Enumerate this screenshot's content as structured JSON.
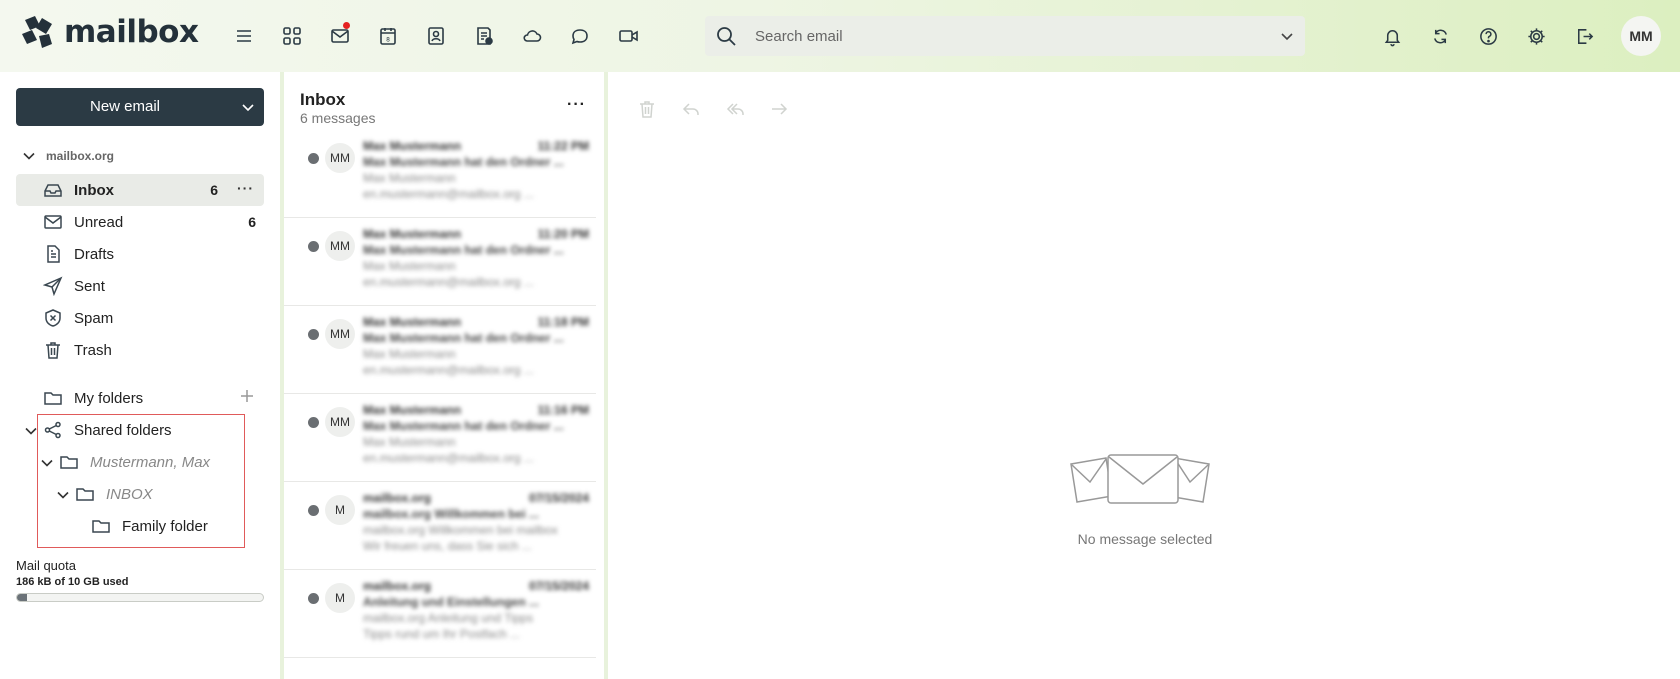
{
  "app": {
    "logo_text": "mailbox"
  },
  "topbar": {
    "icons": [
      "menu-icon",
      "apps-grid-icon",
      "mail-icon",
      "calendar-icon",
      "contacts-icon",
      "tasks-icon",
      "cloud-icon",
      "chat-icon",
      "video-icon"
    ],
    "calendar_day": "8",
    "search_placeholder": "Search email",
    "right_icons": [
      "bell-icon",
      "refresh-icon",
      "help-icon",
      "settings-icon",
      "logout-icon"
    ],
    "avatar_initials": "MM"
  },
  "sidebar": {
    "new_email_label": "New email",
    "account": "mailbox.org",
    "folders": [
      {
        "label": "Inbox",
        "count": "6",
        "icon": "inbox-icon",
        "active": true
      },
      {
        "label": "Unread",
        "count": "6",
        "icon": "envelope-icon"
      },
      {
        "label": "Drafts",
        "icon": "draft-icon"
      },
      {
        "label": "Sent",
        "icon": "send-icon"
      },
      {
        "label": "Spam",
        "icon": "shield-x-icon"
      },
      {
        "label": "Trash",
        "icon": "trash-icon"
      }
    ],
    "my_folders": "My folders",
    "shared_folders": "Shared folders",
    "shared_tree": [
      {
        "label": "Mustermann, Max",
        "italic": true
      },
      {
        "label": "INBOX",
        "italic": true
      },
      {
        "label": "Family folder"
      }
    ],
    "quota_label": "Mail quota",
    "quota_value": "186 kB of 10 GB used",
    "quota_fraction": 0.04
  },
  "list": {
    "title": "Inbox",
    "subtitle": "6 messages",
    "messages": [
      {
        "initials": "MM",
        "from": "Max Mustermann",
        "time": "11:22 PM",
        "subject": "Max Mustermann hat den Ordner ...",
        "line3": "Max Mustermann",
        "line4": "en.mustermann@mailbox.org ..."
      },
      {
        "initials": "MM",
        "from": "Max Mustermann",
        "time": "11:20 PM",
        "subject": "Max Mustermann hat den Ordner ...",
        "line3": "Max Mustermann",
        "line4": "en.mustermann@mailbox.org ..."
      },
      {
        "initials": "MM",
        "from": "Max Mustermann",
        "time": "11:18 PM",
        "subject": "Max Mustermann hat den Ordner ...",
        "line3": "Max Mustermann",
        "line4": "en.mustermann@mailbox.org ..."
      },
      {
        "initials": "MM",
        "from": "Max Mustermann",
        "time": "11:16 PM",
        "subject": "Max Mustermann hat den Ordner ...",
        "line3": "Max Mustermann",
        "line4": "en.mustermann@mailbox.org ..."
      },
      {
        "initials": "M",
        "from": "mailbox.org",
        "time": "07/15/2024",
        "subject": "mailbox.org Willkommen bei ...",
        "line3": "mailbox.org Willkommen bei mailbox",
        "line4": "Wir freuen uns, dass Sie sich ..."
      },
      {
        "initials": "M",
        "from": "mailbox.org",
        "time": "07/15/2024",
        "subject": "Anleitung und Einstellungen ...",
        "line3": "mailbox.org Anleitung und Tipps",
        "line4": "Tipps rund um Ihr Postfach ..."
      }
    ]
  },
  "reader": {
    "tools": [
      "trash-icon",
      "reply-icon",
      "reply-all-icon",
      "forward-icon"
    ],
    "empty_text": "No message selected"
  },
  "colors": {
    "accent_dark": "#2b3a44",
    "highlight_border": "#e05a5a",
    "topbar_gradient_end": "#dcefc0"
  }
}
